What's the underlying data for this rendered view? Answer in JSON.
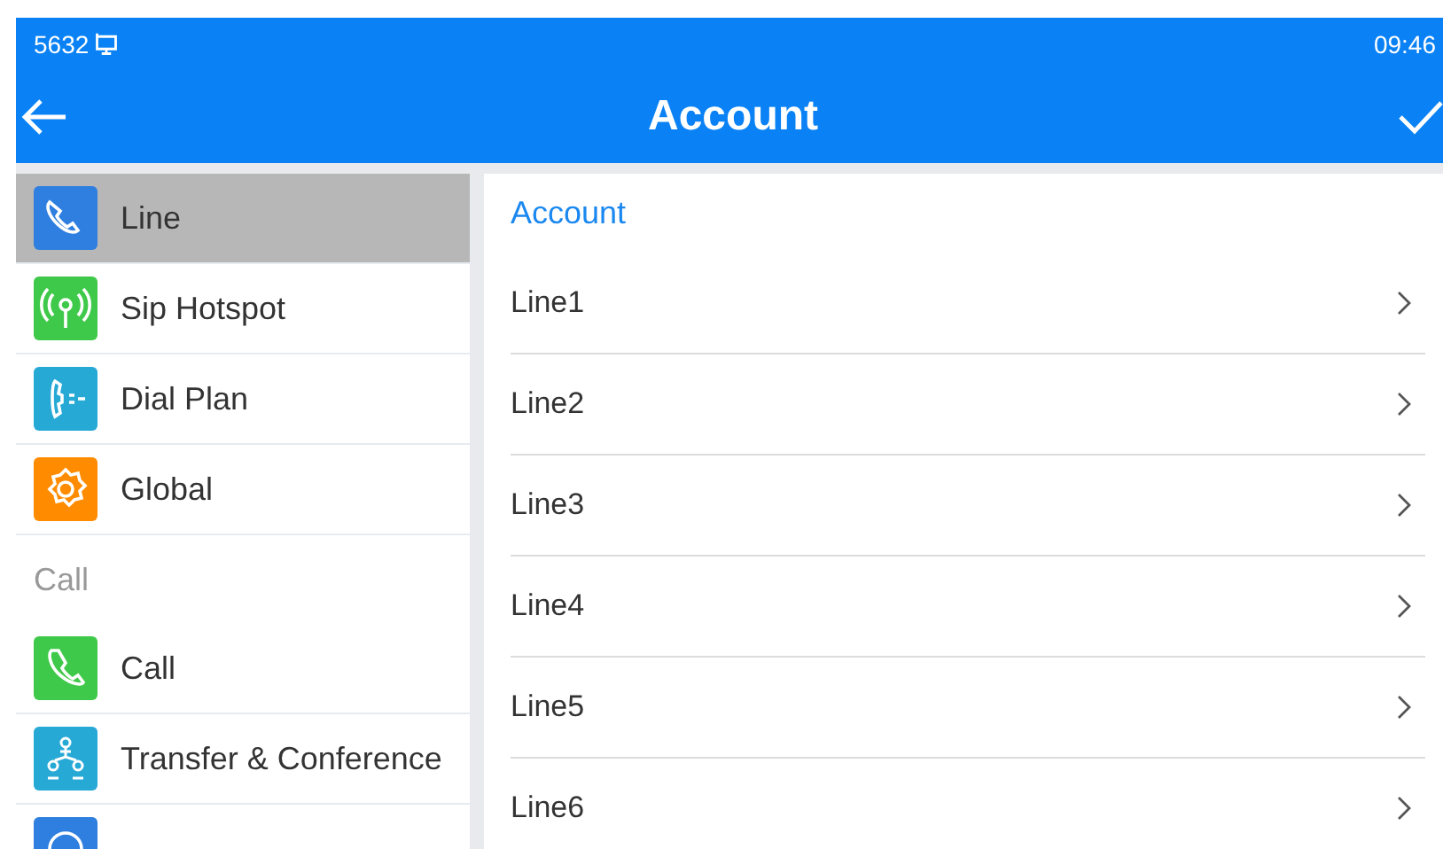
{
  "status_bar": {
    "extension": "5632",
    "time": "09:46"
  },
  "title_bar": {
    "title": "Account"
  },
  "sidebar": {
    "items": [
      {
        "kind": "item",
        "label": "Line",
        "color": "#2f7fe0",
        "selected": true
      },
      {
        "kind": "item",
        "label": "Sip Hotspot",
        "color": "#3fc94a",
        "selected": false
      },
      {
        "kind": "item",
        "label": "Dial Plan",
        "color": "#27a9d6",
        "selected": false
      },
      {
        "kind": "item",
        "label": "Global",
        "color": "#ff8c00",
        "selected": false
      },
      {
        "kind": "header",
        "label": "Call"
      },
      {
        "kind": "item",
        "label": "Call",
        "color": "#3fc94a",
        "selected": false
      },
      {
        "kind": "item",
        "label": "Transfer & Conference",
        "color": "#27a9d6",
        "selected": false
      },
      {
        "kind": "item",
        "color": "#2f7fe0",
        "selected": false
      }
    ]
  },
  "panel": {
    "header": "Account",
    "rows": [
      "Line1",
      "Line2",
      "Line3",
      "Line4",
      "Line5",
      "Line6"
    ]
  }
}
